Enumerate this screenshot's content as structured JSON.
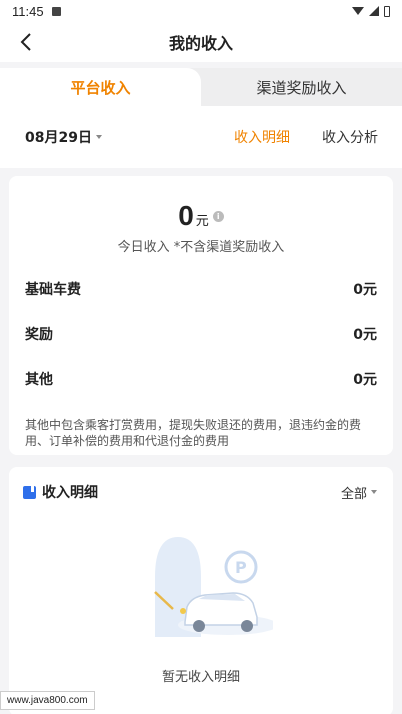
{
  "status_bar": {
    "time": "11:45"
  },
  "header": {
    "title": "我的收入"
  },
  "tabs": [
    {
      "label": "平台收入"
    },
    {
      "label": "渠道奖励收入"
    }
  ],
  "filter": {
    "date": "08月29日",
    "link_detail": "收入明细",
    "link_analysis": "收入分析"
  },
  "summary": {
    "amount": "0",
    "unit": "元",
    "subtitle": "今日收入 *不含渠道奖励收入",
    "rows": [
      {
        "label": "基础车费",
        "value": "0元"
      },
      {
        "label": "奖励",
        "value": "0元"
      },
      {
        "label": "其他",
        "value": "0元"
      }
    ],
    "note": "其他中包含乘客打赏费用，提现失败退还的费用，退违约金的费用、订单补偿的费用和代退付金的费用"
  },
  "detail": {
    "title": "收入明细",
    "filter": "全部",
    "empty_text": "暂无收入明细"
  },
  "watermark": "www.java800.com",
  "colors": {
    "accent": "#f08300",
    "blue": "#2f6fea"
  }
}
